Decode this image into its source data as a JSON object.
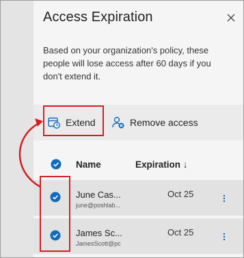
{
  "panel": {
    "title": "Access Expiration",
    "description": "Based on your organization's policy, these people will lose access after 60 days if you don't extend it."
  },
  "toolbar": {
    "extend_label": "Extend",
    "remove_label": "Remove access"
  },
  "table": {
    "columns": {
      "name": "Name",
      "expiration": "Expiration ↓"
    },
    "rows": [
      {
        "name": "June Cas...",
        "email": "june@poshlab...",
        "expiration": "Oct 25",
        "selected": true
      },
      {
        "name": "James Sc...",
        "email": "JamesScott@pc",
        "expiration": "Oct 25",
        "selected": true
      }
    ]
  },
  "colors": {
    "accent": "#0f6cbd",
    "highlight": "#d21f24"
  },
  "icons": [
    "close-icon",
    "calendar-clock-icon",
    "remove-person-icon",
    "checkmark-circle-icon",
    "more-vertical-icon",
    "sort-down-icon"
  ]
}
